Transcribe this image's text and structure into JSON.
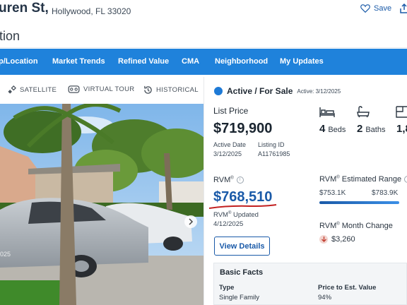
{
  "header": {
    "address_street": "uren St,",
    "address_city": "Hollywood, FL 33020",
    "save_label": "Save",
    "subtitle": "tion"
  },
  "nav": {
    "items": [
      "p/Location",
      "Market Trends",
      "Refined Value",
      "CMA",
      "Neighborhood",
      "My Updates"
    ]
  },
  "map_tabs": {
    "satellite": "SATELLITE",
    "virtual_tour": "VIRTUAL TOUR",
    "historical": "HISTORICAL"
  },
  "photo": {
    "date_fragment": "025"
  },
  "listing": {
    "status": "Active / For Sale",
    "status_date": "Active: 3/12/2025",
    "list_price_label": "List Price",
    "list_price": "$719,900",
    "active_date_label": "Active Date",
    "active_date": "3/12/2025",
    "listing_id_label": "Listing ID",
    "listing_id": "A11761985",
    "beds_value": "4",
    "beds_unit": "Beds",
    "baths_value": "2",
    "baths_unit": "Baths",
    "sqft_fragment": "1,8"
  },
  "rvm": {
    "label": "RVM",
    "reg": "®",
    "value": "$768,510",
    "updated_label": "RVM",
    "updated_suffix": " Updated",
    "updated_date": "4/12/2025",
    "range_label": "Estimated Range",
    "range_low": "$753.1K",
    "range_high": "$783.9K",
    "month_change_label": "Month Change",
    "month_change_value": "$3,260",
    "details_button": "View Details"
  },
  "basic_facts": {
    "title": "Basic Facts",
    "type_label": "Type",
    "type_value": "Single Family",
    "ratio_label": "Price to Est. Value",
    "ratio_value": "94%"
  },
  "colors": {
    "nav_bg": "#1f82db",
    "accent": "#1a5aa8",
    "status_dot": "#1e7ad6",
    "underline_annotation": "#c21f1f"
  }
}
